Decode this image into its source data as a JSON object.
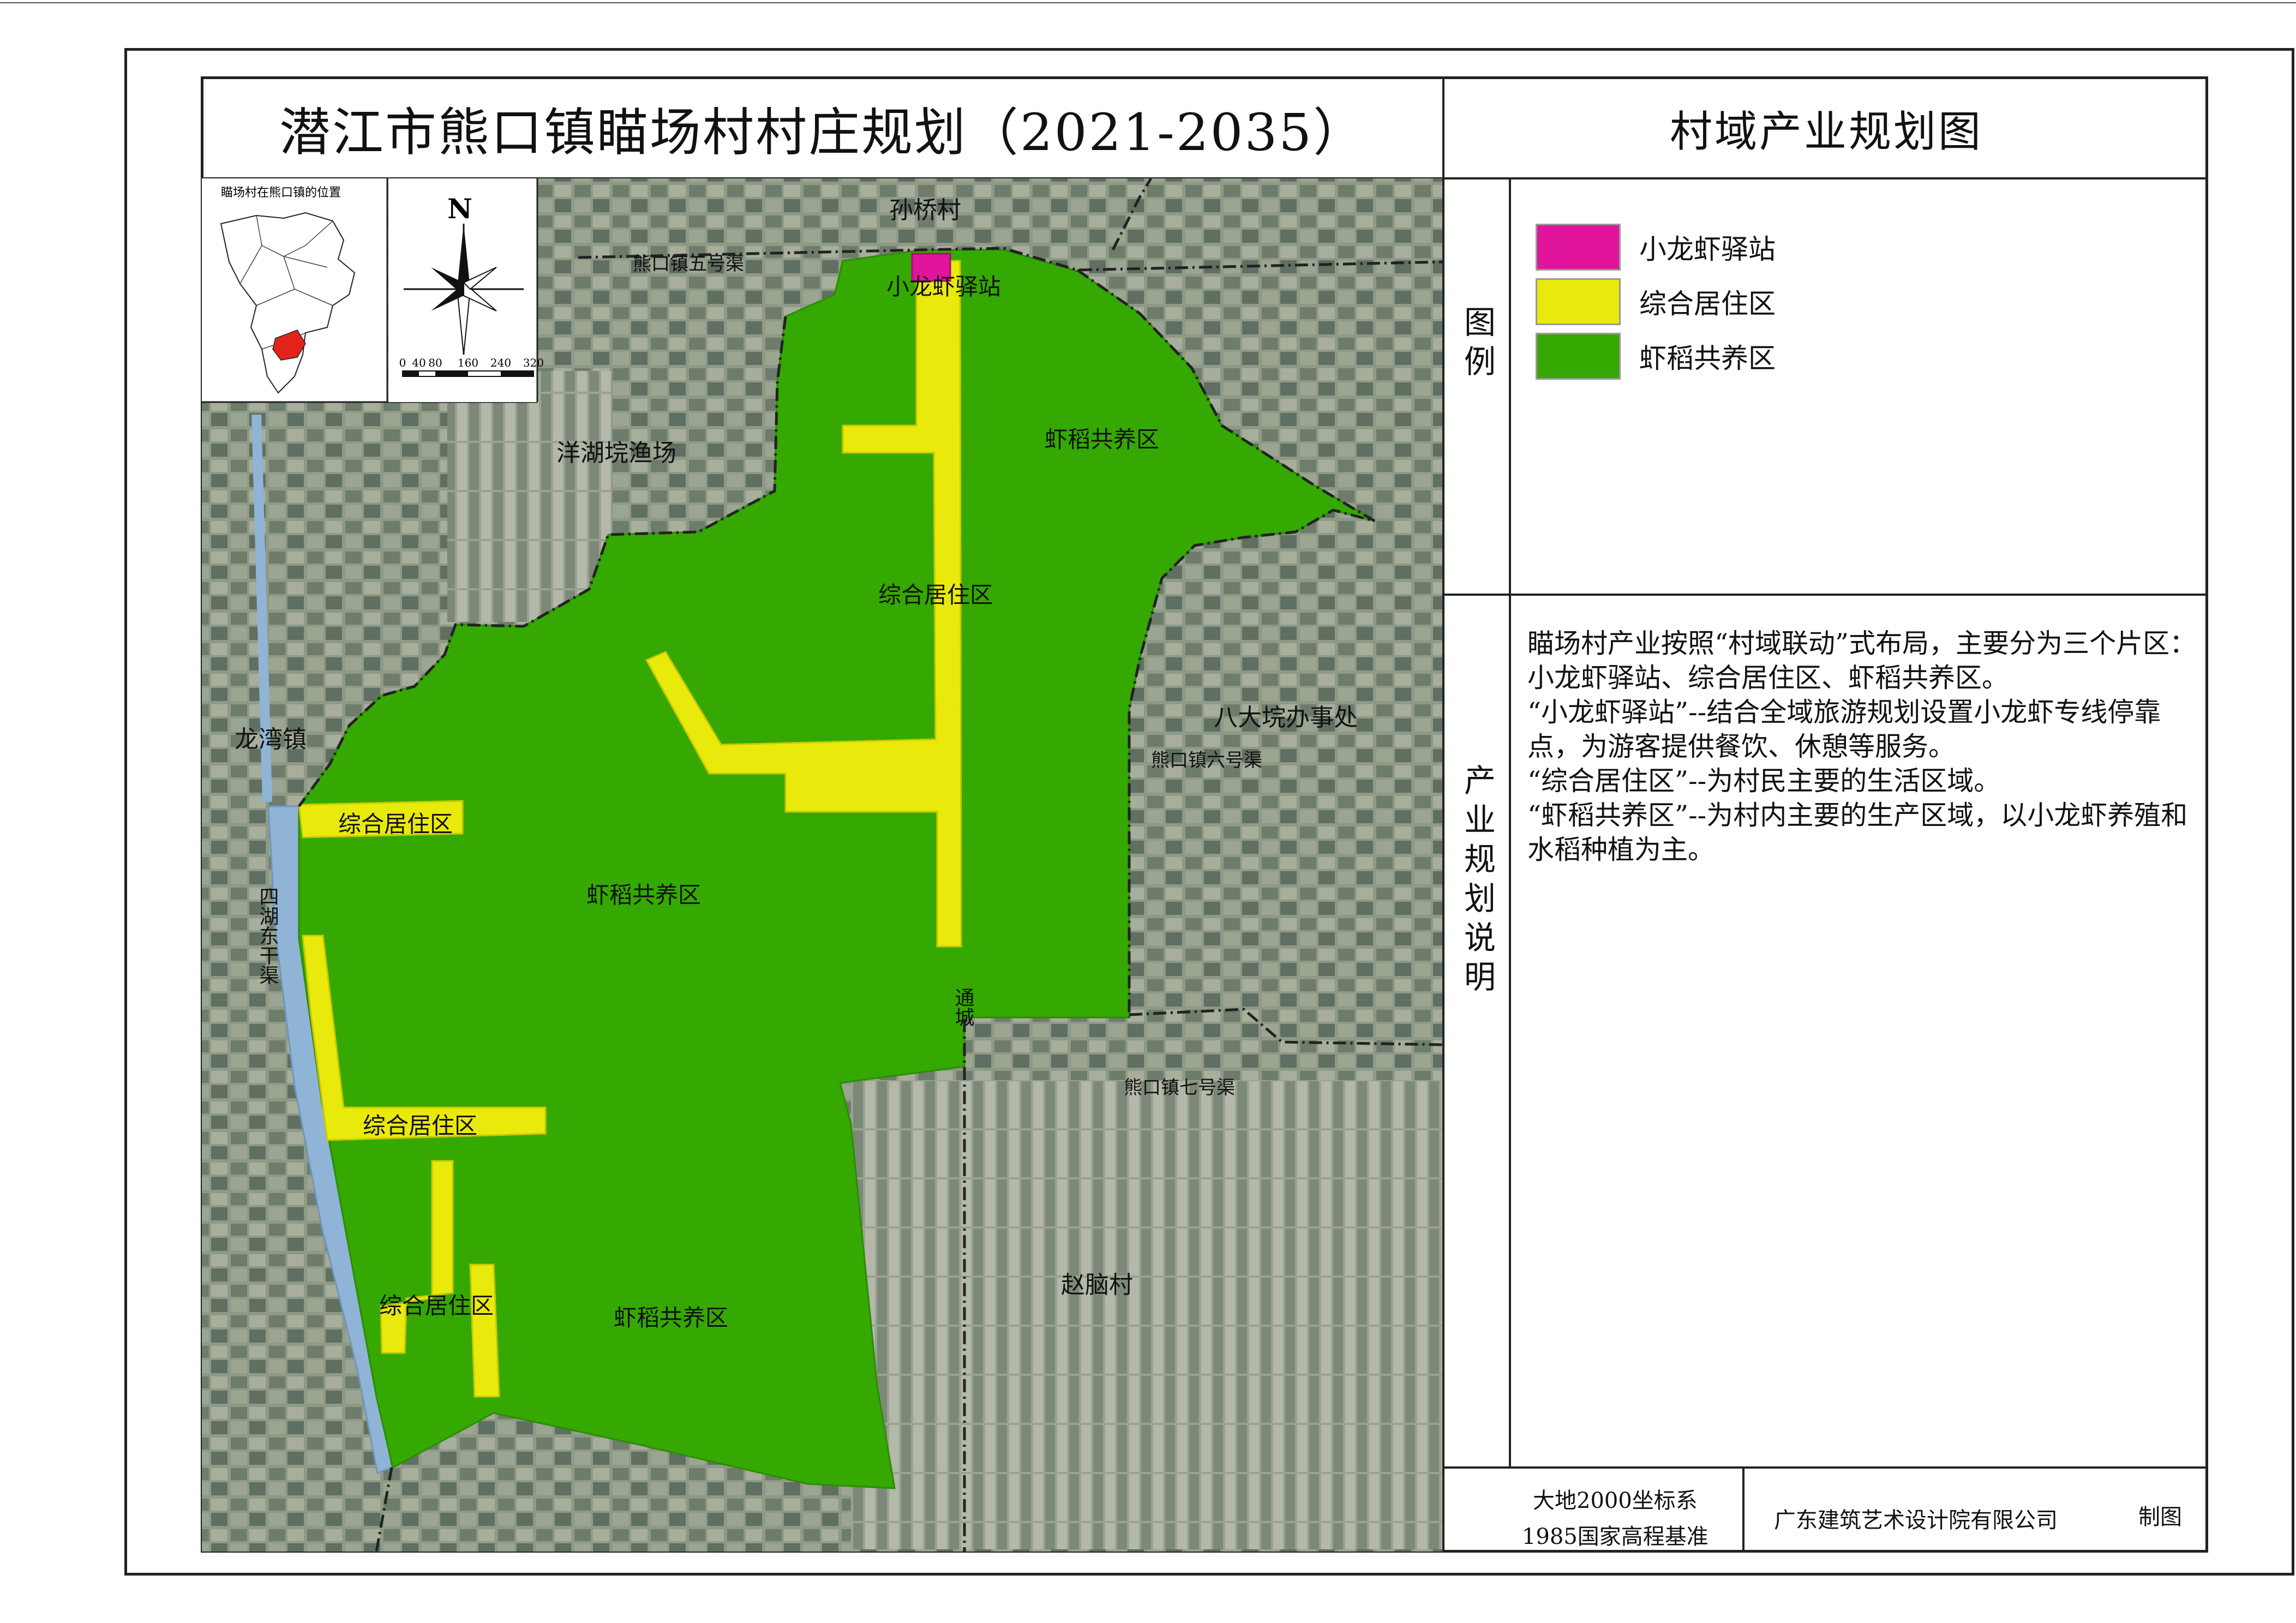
{
  "header": {
    "title": "潜江市熊口镇瞄场村村庄规划（2021-2035）",
    "subtitle": "村域产业规划图"
  },
  "legend": {
    "heading": "图例",
    "items": [
      {
        "label": "小龙虾驿站",
        "color": "#e0159c"
      },
      {
        "label": "综合居住区",
        "color": "#e9ea0c"
      },
      {
        "label": "虾稻共养区",
        "color": "#35a802"
      }
    ]
  },
  "description": {
    "heading": "产业规划说明",
    "paragraphs": [
      "瞄场村产业按照“村域联动”式布局，主要分为三个片区：小龙虾驿站、综合居住区、虾稻共养区。",
      "“小龙虾驿站”--结合全域旅游规划设置小龙虾专线停靠点，为游客提供餐饮、休憩等服务。",
      "“综合居住区”--为村民主要的生活区域。",
      "“虾稻共养区”--为村内主要的生产区域，以小龙虾养殖和水稻种植为主。"
    ]
  },
  "footer": {
    "coord_line1": "大地2000坐标系",
    "coord_line2": "1985国家高程基准",
    "institute": "广东建筑艺术设计院有限公司",
    "made": "制图"
  },
  "inset": {
    "caption": "瞄场村在熊口镇的位置"
  },
  "north_arrow": {
    "letter": "N",
    "scale_ticks": [
      "0",
      "40",
      "80",
      "160",
      "240",
      "320"
    ]
  },
  "map_labels": {
    "sunqiao": "孙桥村",
    "canal5": "熊口镇五号渠",
    "station": "小龙虾驿站",
    "fishery": "洋湖垸渔场",
    "rice_ne": "虾稻共养区",
    "res_center": "综合居住区",
    "badawan": "八大垸办事处",
    "canal6": "熊口镇六号渠",
    "longwan": "龙湾镇",
    "res_w1": "综合居住区",
    "rice_mid": "虾稻共养区",
    "sihu": "四湖东干渠",
    "tongcheng": "通城",
    "canal7": "熊口镇七号渠",
    "res_w2": "综合居住区",
    "zhaonao": "赵脑村",
    "res_sw": "综合居住区",
    "rice_s": "虾稻共养区"
  }
}
